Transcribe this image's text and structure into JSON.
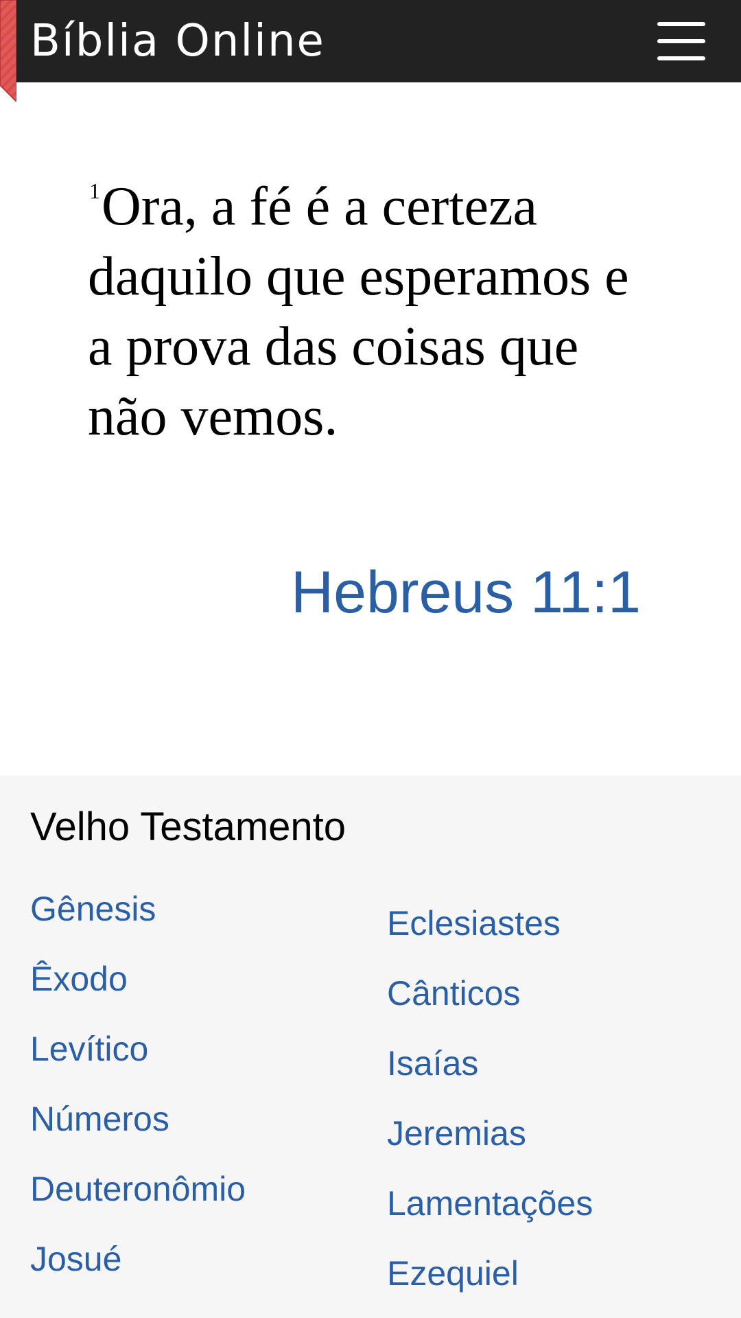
{
  "header": {
    "title": "Bíblia Online",
    "menu_icon": "hamburger-menu-icon",
    "ribbon_icon": "bookmark-ribbon-icon"
  },
  "verse": {
    "number": "1",
    "text": "Ora, a fé é a certeza daquilo que esperamos e a prova das coisas que não vemos.",
    "reference": "Hebreus 11:1"
  },
  "books": {
    "section_title": "Velho Testamento",
    "left_column": [
      "Gênesis",
      "Êxodo",
      "Levítico",
      "Números",
      "Deuteronômio",
      "Josué"
    ],
    "right_column": [
      "Eclesiastes",
      "Cânticos",
      "Isaías",
      "Jeremias",
      "Lamentações",
      "Ezequiel"
    ]
  },
  "colors": {
    "header_bg": "#222222",
    "link": "#2a5fa5",
    "ribbon": "#e05a5a",
    "section_bg": "#f6f6f6"
  }
}
